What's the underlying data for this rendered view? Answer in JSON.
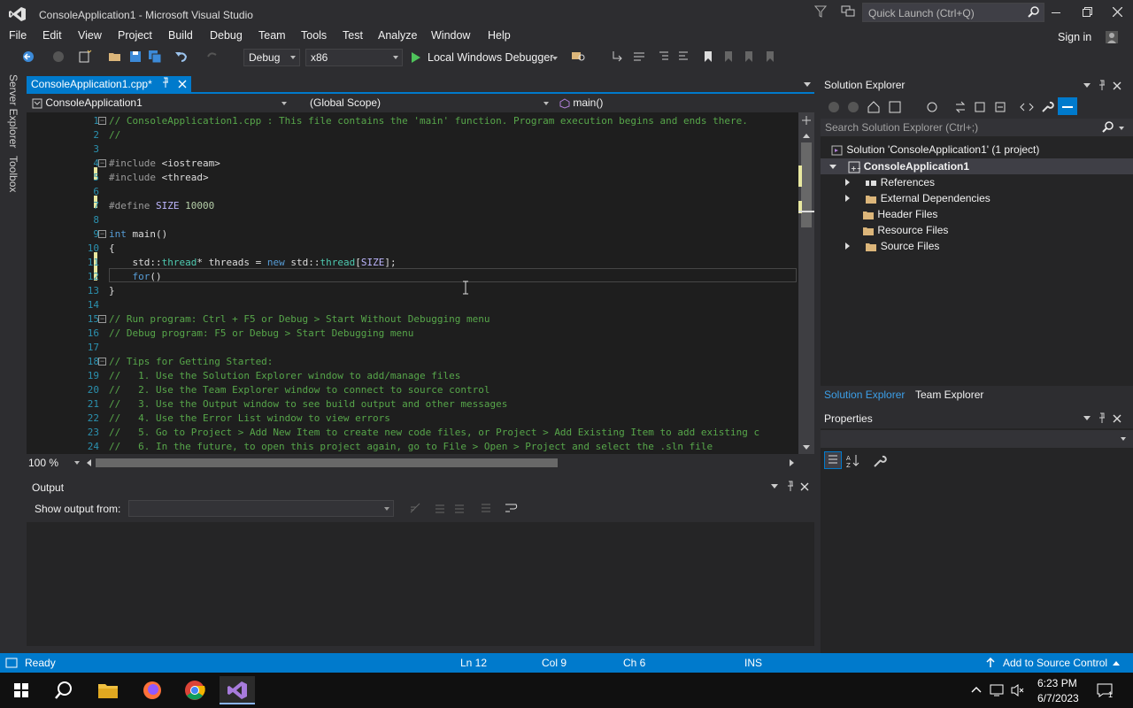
{
  "window": {
    "title": "ConsoleApplication1 - Microsoft Visual Studio"
  },
  "quick_launch": {
    "placeholder": "Quick Launch (Ctrl+Q)"
  },
  "menu": [
    "File",
    "Edit",
    "View",
    "Project",
    "Build",
    "Debug",
    "Team",
    "Tools",
    "Test",
    "Analyze",
    "Window",
    "Help"
  ],
  "sign_in": "Sign in",
  "toolbar": {
    "config": "Debug",
    "platform": "x86",
    "run_label": "Local Windows Debugger"
  },
  "left_strip": {
    "server_explorer": "Server Explorer",
    "toolbox": "Toolbox"
  },
  "doc_tab": {
    "name": "ConsoleApplication1.cpp*"
  },
  "navbar": {
    "project": "ConsoleApplication1",
    "scope": "(Global Scope)",
    "member": "main()"
  },
  "editor": {
    "zoom": "100 %",
    "lines": [
      {
        "n": "1",
        "t": "// ConsoleApplication1.cpp : This file contains the 'main' function. Program execution begins and ends there.",
        "k": "cmt"
      },
      {
        "n": "2",
        "t": "//",
        "k": "cmt"
      },
      {
        "n": "3",
        "t": "",
        "k": ""
      },
      {
        "n": "4",
        "t": "#include <iostream>",
        "k": "pp"
      },
      {
        "n": "5",
        "t": "#include <thread>",
        "k": "pp"
      },
      {
        "n": "6",
        "t": "",
        "k": ""
      },
      {
        "n": "7",
        "t": "#define SIZE 10000",
        "k": "def"
      },
      {
        "n": "8",
        "t": "",
        "k": ""
      },
      {
        "n": "9",
        "t": "int main()",
        "k": "main"
      },
      {
        "n": "10",
        "t": "{",
        "k": ""
      },
      {
        "n": "11",
        "t": "    std::thread* threads = new std::thread[SIZE];",
        "k": "thr"
      },
      {
        "n": "12",
        "t": "    for()",
        "k": "for"
      },
      {
        "n": "13",
        "t": "}",
        "k": ""
      },
      {
        "n": "14",
        "t": "",
        "k": ""
      },
      {
        "n": "15",
        "t": "// Run program: Ctrl + F5 or Debug > Start Without Debugging menu",
        "k": "cmt"
      },
      {
        "n": "16",
        "t": "// Debug program: F5 or Debug > Start Debugging menu",
        "k": "cmt"
      },
      {
        "n": "17",
        "t": "",
        "k": ""
      },
      {
        "n": "18",
        "t": "// Tips for Getting Started:",
        "k": "cmt"
      },
      {
        "n": "19",
        "t": "//   1. Use the Solution Explorer window to add/manage files",
        "k": "cmt"
      },
      {
        "n": "20",
        "t": "//   2. Use the Team Explorer window to connect to source control",
        "k": "cmt"
      },
      {
        "n": "21",
        "t": "//   3. Use the Output window to see build output and other messages",
        "k": "cmt"
      },
      {
        "n": "22",
        "t": "//   4. Use the Error List window to view errors",
        "k": "cmt"
      },
      {
        "n": "23",
        "t": "//   5. Go to Project > Add New Item to create new code files, or Project > Add Existing Item to add existing c",
        "k": "cmt"
      },
      {
        "n": "24",
        "t": "//   6. In the future, to open this project again, go to File > Open > Project and select the .sln file",
        "k": "cmt"
      }
    ]
  },
  "output": {
    "title": "Output",
    "show_from_label": "Show output from:"
  },
  "solution_explorer": {
    "title": "Solution Explorer",
    "search_placeholder": "Search Solution Explorer (Ctrl+;)",
    "solution": "Solution 'ConsoleApplication1' (1 project)",
    "project": "ConsoleApplication1",
    "items": [
      "References",
      "External Dependencies",
      "Header Files",
      "Resource Files",
      "Source Files"
    ],
    "tab_solution": "Solution Explorer",
    "tab_team": "Team Explorer"
  },
  "properties": {
    "title": "Properties"
  },
  "status": {
    "ready": "Ready",
    "ln": "Ln 12",
    "col": "Col 9",
    "ch": "Ch 6",
    "ins": "INS",
    "source_control": "Add to Source Control"
  },
  "taskbar": {
    "time": "6:23 PM",
    "date": "6/7/2023",
    "notifications": "1"
  },
  "colors": {
    "accent": "#007acc",
    "bg": "#2d2d30",
    "editor_bg": "#1e1e1e"
  }
}
